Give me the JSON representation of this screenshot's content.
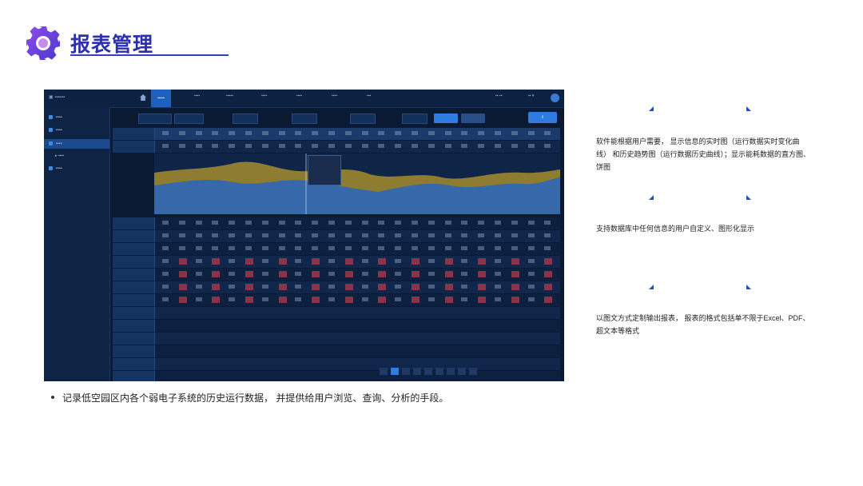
{
  "header": {
    "title": "报表管理"
  },
  "bullet": {
    "text": "记录低空园区内各个弱电子系统的历史运行数据， 并提供给用户浏览、查询、分析的手段。"
  },
  "features": [
    {
      "text": "软件能根据用户需要， 显示信息的实时图（运行数据实时变化曲线） 和历史趋势图（运行数据历史曲线）；显示能耗数据的直方图、饼图"
    },
    {
      "text": "支持数据库中任何信息的用户自定义、图形化显示"
    },
    {
      "text": "以图文方式定制输出报表， 报表的格式包括单不限于Excel、PDF、超文本等格式"
    }
  ],
  "colors": {
    "accent": "#2b2fb0",
    "gear": "#6a3fd0",
    "triangle": "#1e4fbf",
    "screen_bg": "#0b1a33"
  },
  "icons": [
    "gear-icon",
    "home-icon",
    "user-icon",
    "triangle-marker-icon"
  ]
}
